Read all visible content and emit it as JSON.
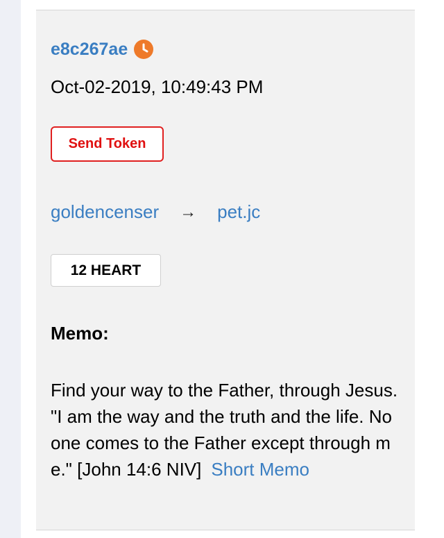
{
  "transaction": {
    "id": "e8c267ae",
    "status_icon": "clock-icon",
    "timestamp": "Oct-02-2019, 10:49:43 PM",
    "send_token_label": "Send Token",
    "from": "goldencenser",
    "arrow": "→",
    "to": "pet.jc",
    "amount": "12 HEART",
    "memo_label": "Memo:",
    "memo": "Find your way to the Father, through Jesus. \"I am the way and the truth and the life. No one comes to the Father except through me.\" [John 14:6 NIV]",
    "short_memo_label": "Short Memo"
  },
  "colors": {
    "link": "#3a7ec2",
    "accent_orange": "#ee7a2a",
    "send_token_red": "#e01010",
    "card_bg": "#f2f2f2"
  }
}
